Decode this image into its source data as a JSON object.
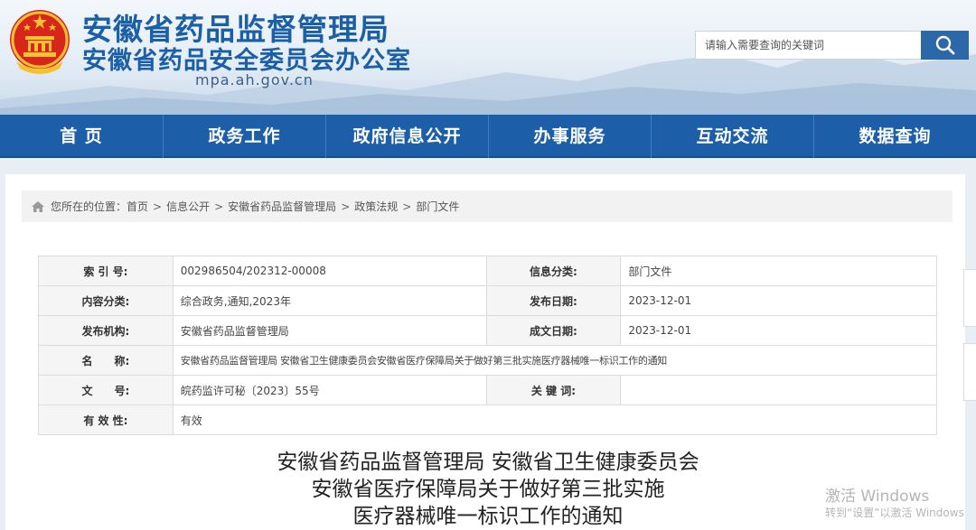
{
  "header": {
    "title_main": "安徽省药品监督管理局",
    "title_sub": "安徽省药品安全委员会办公室",
    "domain": "mpa.ah.gov.cn",
    "search_placeholder": "请输入需要查询的关键词"
  },
  "nav": {
    "items": [
      "首 页",
      "政务工作",
      "政府信息公开",
      "办事服务",
      "互动交流",
      "数据查询"
    ]
  },
  "breadcrumb": {
    "prefix": "您所在的位置：",
    "items": [
      "首页",
      "信息公开",
      "安徽省药品监督管理局",
      "政策法规",
      "部门文件"
    ],
    "separator": ">"
  },
  "meta": {
    "index_label": "索 引 号:",
    "index_value": "002986504/202312-00008",
    "category_label": "信息分类:",
    "category_value": "部门文件",
    "content_label": "内容分类:",
    "content_value": "综合政务,通知,2023年",
    "publish_date_label": "发布日期:",
    "publish_date_value": "2023-12-01",
    "org_label": "发布机构:",
    "org_value": "安徽省药品监督管理局",
    "created_date_label": "成文日期:",
    "created_date_value": "2023-12-01",
    "name_label": "名　　称:",
    "name_value": "安徽省药品监督管理局 安徽省卫生健康委员会安徽省医疗保障局关于做好第三批实施医疗器械唯一标识工作的通知",
    "docno_label": "文　　号:",
    "docno_value": "皖药监许可秘〔2023〕55号",
    "keywords_label": "关 键 词:",
    "keywords_value": "",
    "validity_label": "有 效 性:",
    "validity_value": "有效"
  },
  "article": {
    "title_lines": [
      "安徽省药品监督管理局 安徽省卫生健康委员会",
      "安徽省医疗保障局关于做好第三批实施",
      "医疗器械唯一标识工作的通知"
    ]
  },
  "watermark": {
    "line1": "激活 Windows",
    "line2": "转到“设置”以激活 Windows"
  },
  "colors": {
    "brand_blue": "#1b5fa6",
    "nav_blue": "#1d5ea8",
    "search_button": "#2c68a7"
  }
}
